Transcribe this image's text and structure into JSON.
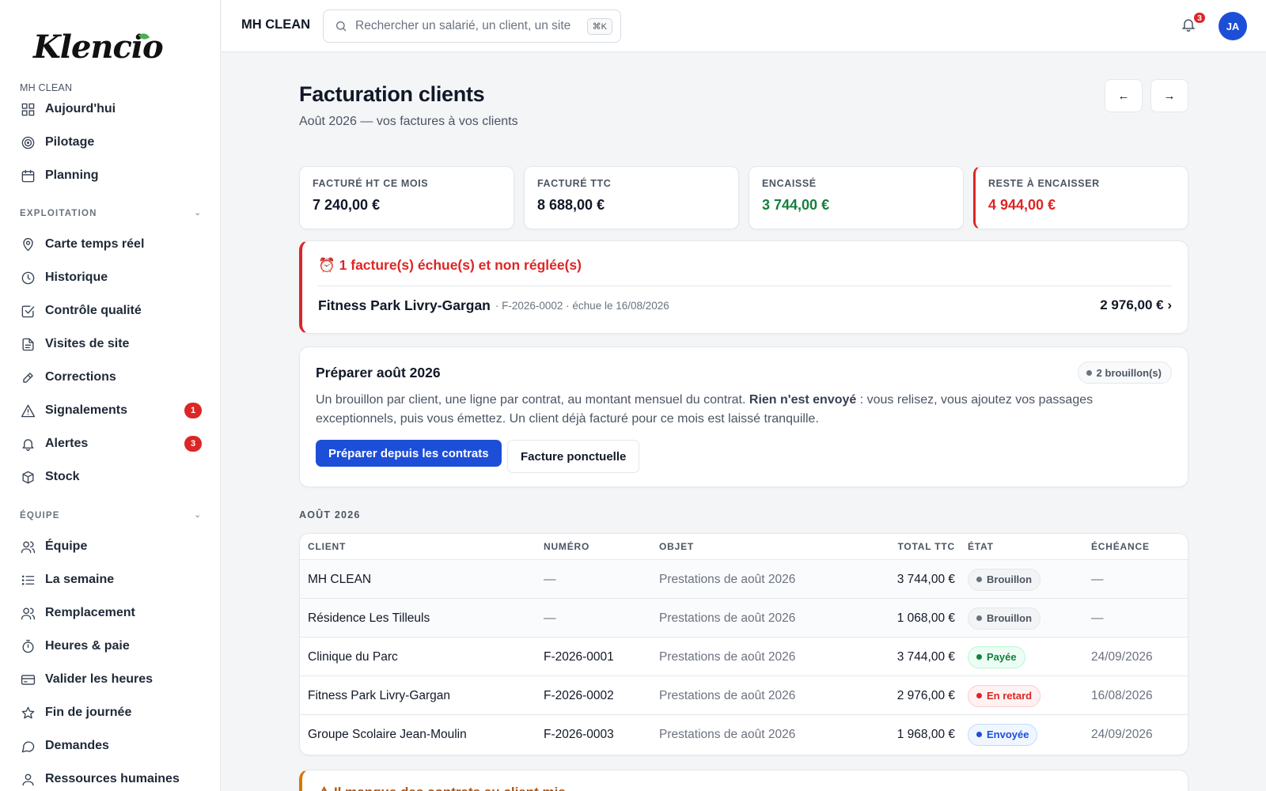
{
  "app": {
    "logo": "Klencio",
    "org": "MH CLEAN"
  },
  "sidebar": {
    "org_label": "MH CLEAN",
    "top_items": [
      {
        "label": "Aujourd'hui",
        "icon": "grid-icon"
      },
      {
        "label": "Pilotage",
        "icon": "target-icon"
      },
      {
        "label": "Planning",
        "icon": "calendar-icon"
      }
    ],
    "section_exploitation": "EXPLOITATION",
    "exploitation_items": [
      {
        "label": "Carte temps réel",
        "icon": "map-pin-icon"
      },
      {
        "label": "Historique",
        "icon": "clock-icon"
      },
      {
        "label": "Contrôle qualité",
        "icon": "check-square-icon"
      },
      {
        "label": "Visites de site",
        "icon": "file-icon"
      },
      {
        "label": "Corrections",
        "icon": "pen-icon"
      },
      {
        "label": "Signalements",
        "icon": "alert-triangle-icon",
        "badge": "1"
      },
      {
        "label": "Alertes",
        "icon": "bell-icon",
        "badge": "3"
      },
      {
        "label": "Stock",
        "icon": "box-icon"
      }
    ],
    "section_equipe": "ÉQUIPE",
    "equipe_items": [
      {
        "label": "Équipe",
        "icon": "users-icon"
      },
      {
        "label": "La semaine",
        "icon": "list-icon"
      },
      {
        "label": "Remplacement",
        "icon": "users-swap-icon"
      },
      {
        "label": "Heures & paie",
        "icon": "stopwatch-icon"
      },
      {
        "label": "Valider les heures",
        "icon": "credit-card-icon"
      },
      {
        "label": "Fin de journée",
        "icon": "star-icon"
      },
      {
        "label": "Demandes",
        "icon": "message-icon"
      },
      {
        "label": "Ressources humaines",
        "icon": "user-icon"
      }
    ]
  },
  "topbar": {
    "org_name": "MH CLEAN",
    "search_placeholder": "Rechercher un salarié, un client, un site",
    "shortcut": "⌘K",
    "notif_count": "3",
    "avatar_initials": "JA"
  },
  "page": {
    "title": "Facturation clients",
    "subtitle": "Août 2026 — vos factures à vos clients",
    "prev_arrow": "←",
    "next_arrow": "→"
  },
  "kpis": [
    {
      "label": "FACTURÉ HT CE MOIS",
      "value": "7 240,00 €"
    },
    {
      "label": "FACTURÉ TTC",
      "value": "8 688,00 €"
    },
    {
      "label": "ENCAISSÉ",
      "value": "3 744,00 €"
    },
    {
      "label": "RESTE À ENCAISSER",
      "value": "4 944,00 €"
    }
  ],
  "overdue": {
    "title": "⏰ 1 facture(s) échue(s) et non réglée(s)",
    "client": "Fitness Park Livry-Gargan",
    "meta": "· F-2026-0002 · échue le 16/08/2026",
    "amount": "2 976,00 € ›"
  },
  "prepare": {
    "title": "Préparer août 2026",
    "badge": "2 brouillon(s)",
    "desc_part1": "Un brouillon par client, une ligne par contrat, au montant mensuel du contrat.",
    "desc_bold": "Rien n'est envoyé",
    "desc_part2": " : vous relisez, vous ajoutez vos passages exceptionnels, puis vous émettez. Un client déjà facturé pour ce mois est laissé tranquille.",
    "btn_primary": "Préparer depuis les contrats",
    "btn_secondary": "Facture ponctuelle"
  },
  "invoices": {
    "month_label": "AOÛT 2026",
    "headers": {
      "client": "CLIENT",
      "number": "NUMÉRO",
      "object": "OBJET",
      "total": "TOTAL TTC",
      "status": "ÉTAT",
      "due": "ÉCHÉANCE"
    },
    "rows": [
      {
        "client": "MH CLEAN",
        "number": "—",
        "object": "Prestations de août 2026",
        "total": "3 744,00 €",
        "status": "Brouillon",
        "status_kind": "draft",
        "due": "—"
      },
      {
        "client": "Résidence Les Tilleuls",
        "number": "—",
        "object": "Prestations de août 2026",
        "total": "1 068,00 €",
        "status": "Brouillon",
        "status_kind": "draft",
        "due": "—"
      },
      {
        "client": "Clinique du Parc",
        "number": "F-2026-0001",
        "object": "Prestations de août 2026",
        "total": "3 744,00 €",
        "status": "Payée",
        "status_kind": "paid",
        "due": "24/09/2026"
      },
      {
        "client": "Fitness Park Livry-Gargan",
        "number": "F-2026-0002",
        "object": "Prestations de août 2026",
        "total": "2 976,00 €",
        "status": "En retard",
        "status_kind": "late",
        "due": "16/08/2026"
      },
      {
        "client": "Groupe Scolaire Jean-Moulin",
        "number": "F-2026-0003",
        "object": "Prestations de août 2026",
        "total": "1 968,00 €",
        "status": "Envoyée",
        "status_kind": "sent",
        "due": "24/09/2026"
      }
    ]
  },
  "bottom_card": {
    "title": "⚠ Il manque des contrats au client mis..."
  },
  "colors": {
    "accent": "#1d4ed8",
    "danger": "#dc2626",
    "success": "#15803d",
    "warning": "#d97706"
  }
}
